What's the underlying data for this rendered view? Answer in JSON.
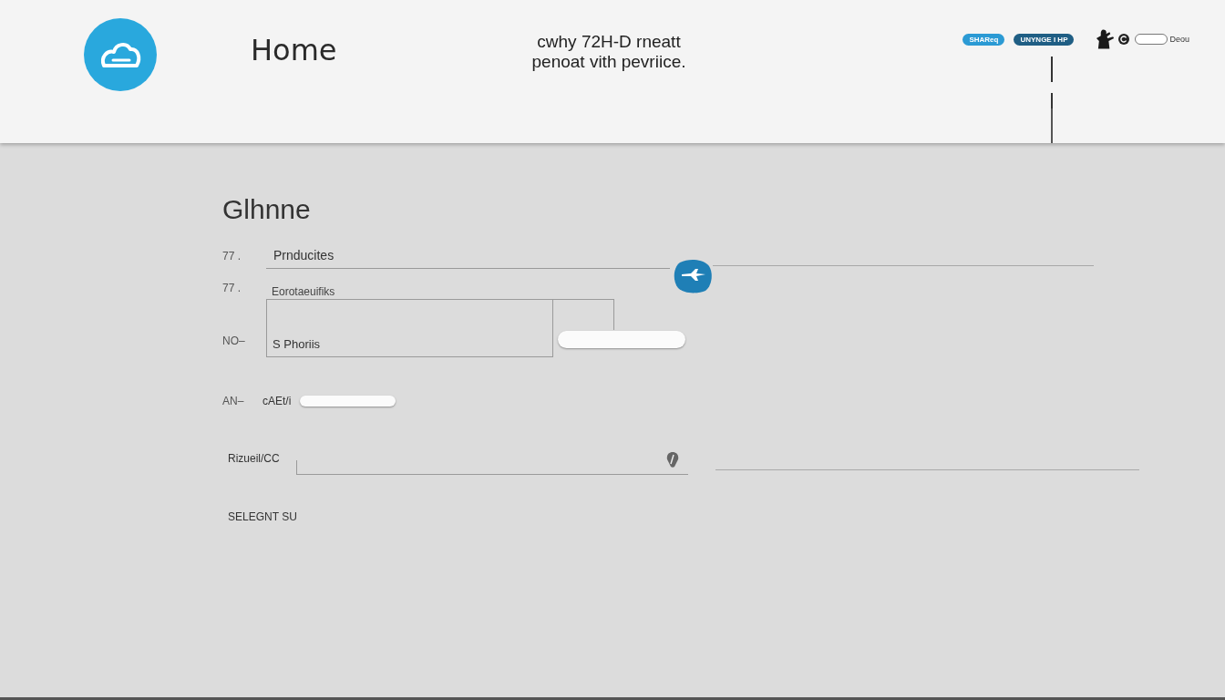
{
  "header": {
    "title": "Home",
    "tagline": [
      "cwhy 72H-D rneatt",
      "penoat vith pevriice."
    ],
    "pills": [
      {
        "label": "SHAReq",
        "color": "#2b9ad4"
      },
      {
        "label": "UNYNGE I HP",
        "color": "#1f5e84"
      }
    ],
    "user": "Deou"
  },
  "form": {
    "heading": "Glhnne",
    "rows": [
      {
        "kind": "value-line",
        "marker": "77 .",
        "value": "Prnducites"
      },
      {
        "kind": "box-field",
        "marker": "77 .",
        "label": "Eorotaeuifiks",
        "side_marker": "NO–",
        "value": "S Phoriis"
      },
      {
        "kind": "pill-field",
        "marker": "AN–",
        "label": "cAEt/i"
      },
      {
        "kind": "label-line",
        "label": "Rizueil/CC"
      },
      {
        "kind": "text",
        "label": "SELEGNT SU"
      }
    ]
  }
}
